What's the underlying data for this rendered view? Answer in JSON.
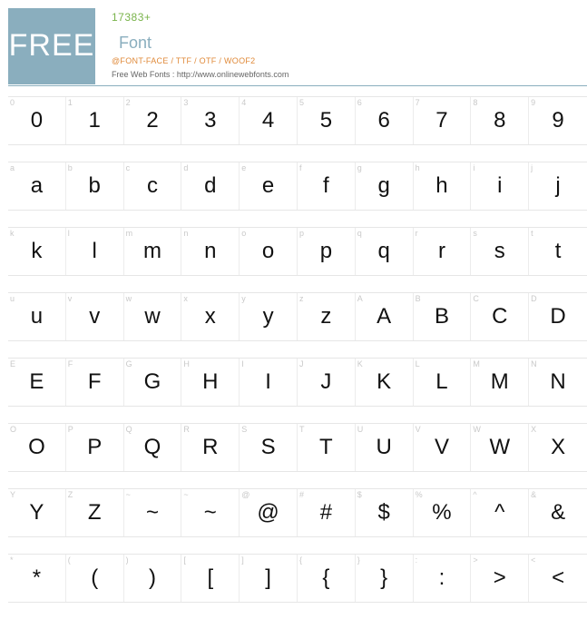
{
  "header": {
    "logo_text": "FREE",
    "font_id": "17383+",
    "font_name": "Font",
    "formats": "@FONT-FACE / TTF / OTF / WOOF2",
    "credit": "Free Web Fonts : http://www.onlinewebfonts.com"
  },
  "rows": [
    [
      {
        "label": "0",
        "glyph": "0"
      },
      {
        "label": "1",
        "glyph": "1"
      },
      {
        "label": "2",
        "glyph": "2"
      },
      {
        "label": "3",
        "glyph": "3"
      },
      {
        "label": "4",
        "glyph": "4"
      },
      {
        "label": "5",
        "glyph": "5"
      },
      {
        "label": "6",
        "glyph": "6"
      },
      {
        "label": "7",
        "glyph": "7"
      },
      {
        "label": "8",
        "glyph": "8"
      },
      {
        "label": "9",
        "glyph": "9"
      }
    ],
    [
      {
        "label": "a",
        "glyph": "a"
      },
      {
        "label": "b",
        "glyph": "b"
      },
      {
        "label": "c",
        "glyph": "c"
      },
      {
        "label": "d",
        "glyph": "d"
      },
      {
        "label": "e",
        "glyph": "e"
      },
      {
        "label": "f",
        "glyph": "f"
      },
      {
        "label": "g",
        "glyph": "g"
      },
      {
        "label": "h",
        "glyph": "h"
      },
      {
        "label": "i",
        "glyph": "i"
      },
      {
        "label": "j",
        "glyph": "j"
      }
    ],
    [
      {
        "label": "k",
        "glyph": "k"
      },
      {
        "label": "l",
        "glyph": "l"
      },
      {
        "label": "m",
        "glyph": "m"
      },
      {
        "label": "n",
        "glyph": "n"
      },
      {
        "label": "o",
        "glyph": "o"
      },
      {
        "label": "p",
        "glyph": "p"
      },
      {
        "label": "q",
        "glyph": "q"
      },
      {
        "label": "r",
        "glyph": "r"
      },
      {
        "label": "s",
        "glyph": "s"
      },
      {
        "label": "t",
        "glyph": "t"
      }
    ],
    [
      {
        "label": "u",
        "glyph": "u"
      },
      {
        "label": "v",
        "glyph": "v"
      },
      {
        "label": "w",
        "glyph": "w"
      },
      {
        "label": "x",
        "glyph": "x"
      },
      {
        "label": "y",
        "glyph": "y"
      },
      {
        "label": "z",
        "glyph": "z"
      },
      {
        "label": "A",
        "glyph": "A"
      },
      {
        "label": "B",
        "glyph": "B"
      },
      {
        "label": "C",
        "glyph": "C"
      },
      {
        "label": "D",
        "glyph": "D"
      }
    ],
    [
      {
        "label": "E",
        "glyph": "E"
      },
      {
        "label": "F",
        "glyph": "F"
      },
      {
        "label": "G",
        "glyph": "G"
      },
      {
        "label": "H",
        "glyph": "H"
      },
      {
        "label": "I",
        "glyph": "I"
      },
      {
        "label": "J",
        "glyph": "J"
      },
      {
        "label": "K",
        "glyph": "K"
      },
      {
        "label": "L",
        "glyph": "L"
      },
      {
        "label": "M",
        "glyph": "M"
      },
      {
        "label": "N",
        "glyph": "N"
      }
    ],
    [
      {
        "label": "O",
        "glyph": "O"
      },
      {
        "label": "P",
        "glyph": "P"
      },
      {
        "label": "Q",
        "glyph": "Q"
      },
      {
        "label": "R",
        "glyph": "R"
      },
      {
        "label": "S",
        "glyph": "S"
      },
      {
        "label": "T",
        "glyph": "T"
      },
      {
        "label": "U",
        "glyph": "U"
      },
      {
        "label": "V",
        "glyph": "V"
      },
      {
        "label": "W",
        "glyph": "W"
      },
      {
        "label": "X",
        "glyph": "X"
      }
    ],
    [
      {
        "label": "Y",
        "glyph": "Y"
      },
      {
        "label": "Z",
        "glyph": "Z"
      },
      {
        "label": "~",
        "glyph": "~"
      },
      {
        "label": "~",
        "glyph": "~"
      },
      {
        "label": "@",
        "glyph": "@"
      },
      {
        "label": "#",
        "glyph": "#"
      },
      {
        "label": "$",
        "glyph": "$"
      },
      {
        "label": "%",
        "glyph": "%"
      },
      {
        "label": "^",
        "glyph": "^"
      },
      {
        "label": "&",
        "glyph": "&"
      }
    ],
    [
      {
        "label": "*",
        "glyph": "*"
      },
      {
        "label": "(",
        "glyph": "("
      },
      {
        "label": ")",
        "glyph": ")"
      },
      {
        "label": "[",
        "glyph": "["
      },
      {
        "label": "]",
        "glyph": "]"
      },
      {
        "label": "{",
        "glyph": "{"
      },
      {
        "label": "}",
        "glyph": "}"
      },
      {
        "label": ":",
        "glyph": ":"
      },
      {
        "label": ">",
        "glyph": ">"
      },
      {
        "label": "<",
        "glyph": "<"
      }
    ]
  ]
}
